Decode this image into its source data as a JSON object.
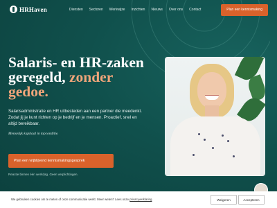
{
  "header": {
    "logo_text": "HRHaven",
    "nav": [
      "Diensten",
      "Sectoren",
      "Werkwijze",
      "Inzichten",
      "Nieuws",
      "Over ons",
      "Contact"
    ],
    "cta_label": "Plan een kennismaking"
  },
  "hero": {
    "headline_line1": "Salaris- en HR-zaken",
    "headline_line2_plain": "geregeld,",
    "headline_line2_accent": " zonder",
    "headline_line3_accent": "gedoe.",
    "intro": "Salarisadministratie en HR uitbesteden aan een partner die meedenkt. Zodat jij je kunt richten op je bedrijf en je mensen. Proactief, snel en altijd bereikbaar.",
    "tagline": "Menselijk kapitaal in topconditie.",
    "cta_label": "Plan een vrijblijvend kennismakingsgesprek",
    "cta_note": "Reactie binnen één werkdag. Geen verplichtingen."
  },
  "cookie": {
    "text": "We gebruiken cookies om te meten of onze communicatie werkt. Meer weten? Lees onze ",
    "link": "privacyverklaring",
    "suffix": ".",
    "reject_label": "Weigeren",
    "accept_label": "Accepteren"
  },
  "colors": {
    "background": "#0f4a47",
    "accent_orange": "#d9622b",
    "accent_text": "#f0a57a"
  },
  "icons": [
    "anchor-logo-icon",
    "chat-avatar-icon"
  ]
}
